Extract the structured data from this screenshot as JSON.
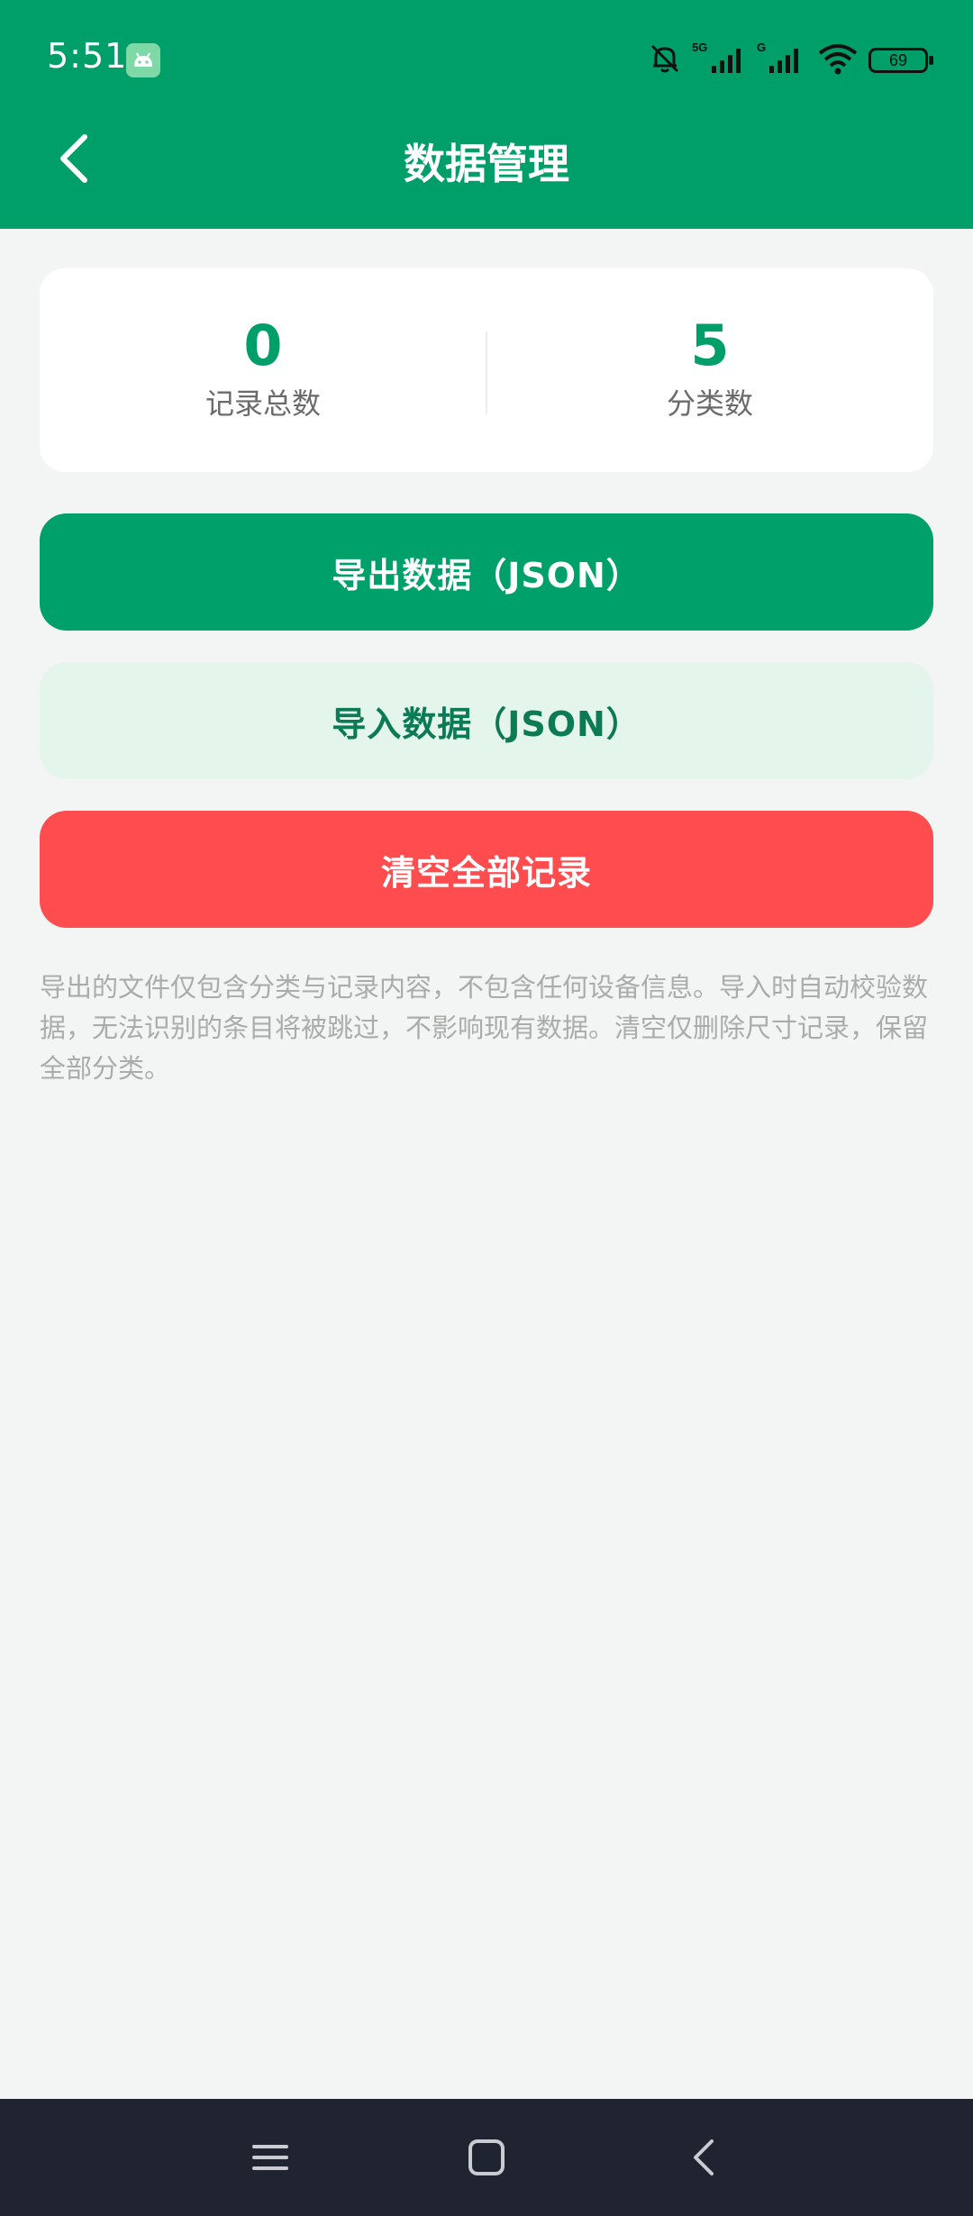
{
  "status_bar": {
    "time": "5:51",
    "battery_level": "69",
    "icons": [
      "app-notification-icon",
      "mute-bell-icon",
      "signal-5g-icon",
      "signal-g-icon",
      "wifi-icon",
      "battery-icon"
    ]
  },
  "header": {
    "title": "数据管理",
    "back_icon": "chevron-left-icon",
    "background_color": "#009E69"
  },
  "stats": {
    "record_total_value": "0",
    "record_total_label": "记录总数",
    "category_count_value": "5",
    "category_count_label": "分类数"
  },
  "actions": {
    "export_label": "导出数据（JSON）",
    "import_label": "导入数据（JSON）",
    "clear_label": "清空全部记录"
  },
  "note": "导出的文件仅包含分类与记录内容，不包含任何设备信息。导入时自动校验数据，无法识别的条目将被跳过，不影响现有数据。清空仅删除尺寸记录，保留全部分类。",
  "nav_bar": {
    "icons": [
      "menu-icon",
      "home-square-icon",
      "back-icon"
    ]
  },
  "colors": {
    "accent": "#009E69",
    "danger": "#FF4C4F",
    "import_bg": "#E4F5EC"
  }
}
